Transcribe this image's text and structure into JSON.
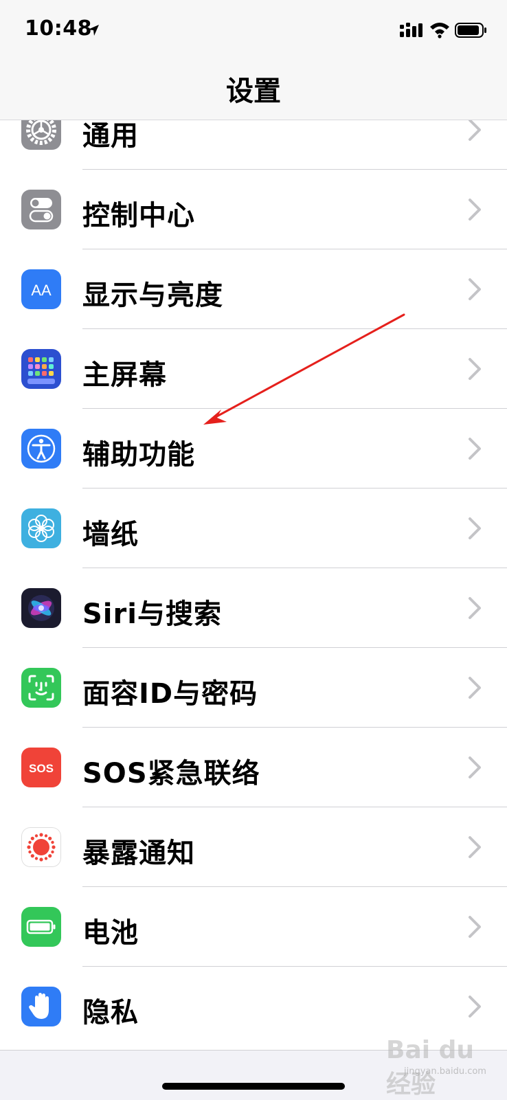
{
  "status_bar": {
    "time": "10:48"
  },
  "nav": {
    "title": "设置"
  },
  "rows": [
    {
      "label": "通用",
      "icon": "gear-icon"
    },
    {
      "label": "控制中心",
      "icon": "toggle-icon"
    },
    {
      "label": "显示与亮度",
      "icon": "text-size-icon",
      "icon_text": "AA"
    },
    {
      "label": "主屏幕",
      "icon": "app-grid-icon"
    },
    {
      "label": "辅助功能",
      "icon": "accessibility-icon"
    },
    {
      "label": "墙纸",
      "icon": "flower-icon"
    },
    {
      "label": "Siri与搜索",
      "icon": "siri-icon"
    },
    {
      "label": "面容ID与密码",
      "icon": "face-id-icon"
    },
    {
      "label": "SOS紧急联络",
      "icon": "sos-icon",
      "icon_text": "SOS"
    },
    {
      "label": "暴露通知",
      "icon": "exposure-icon"
    },
    {
      "label": "电池",
      "icon": "battery-icon"
    },
    {
      "label": "隐私",
      "icon": "hand-icon"
    }
  ],
  "watermark": {
    "text": "Bai du 经验",
    "sub": "jingyan.baidu.com"
  },
  "colors": {
    "gray": "#8e8e93",
    "blue": "#2f7cf6",
    "dark_blue": "#2c4fd0",
    "teal": "#3eb0e0",
    "green": "#33c759",
    "red": "#f04338",
    "arrow": "#e5201c"
  }
}
